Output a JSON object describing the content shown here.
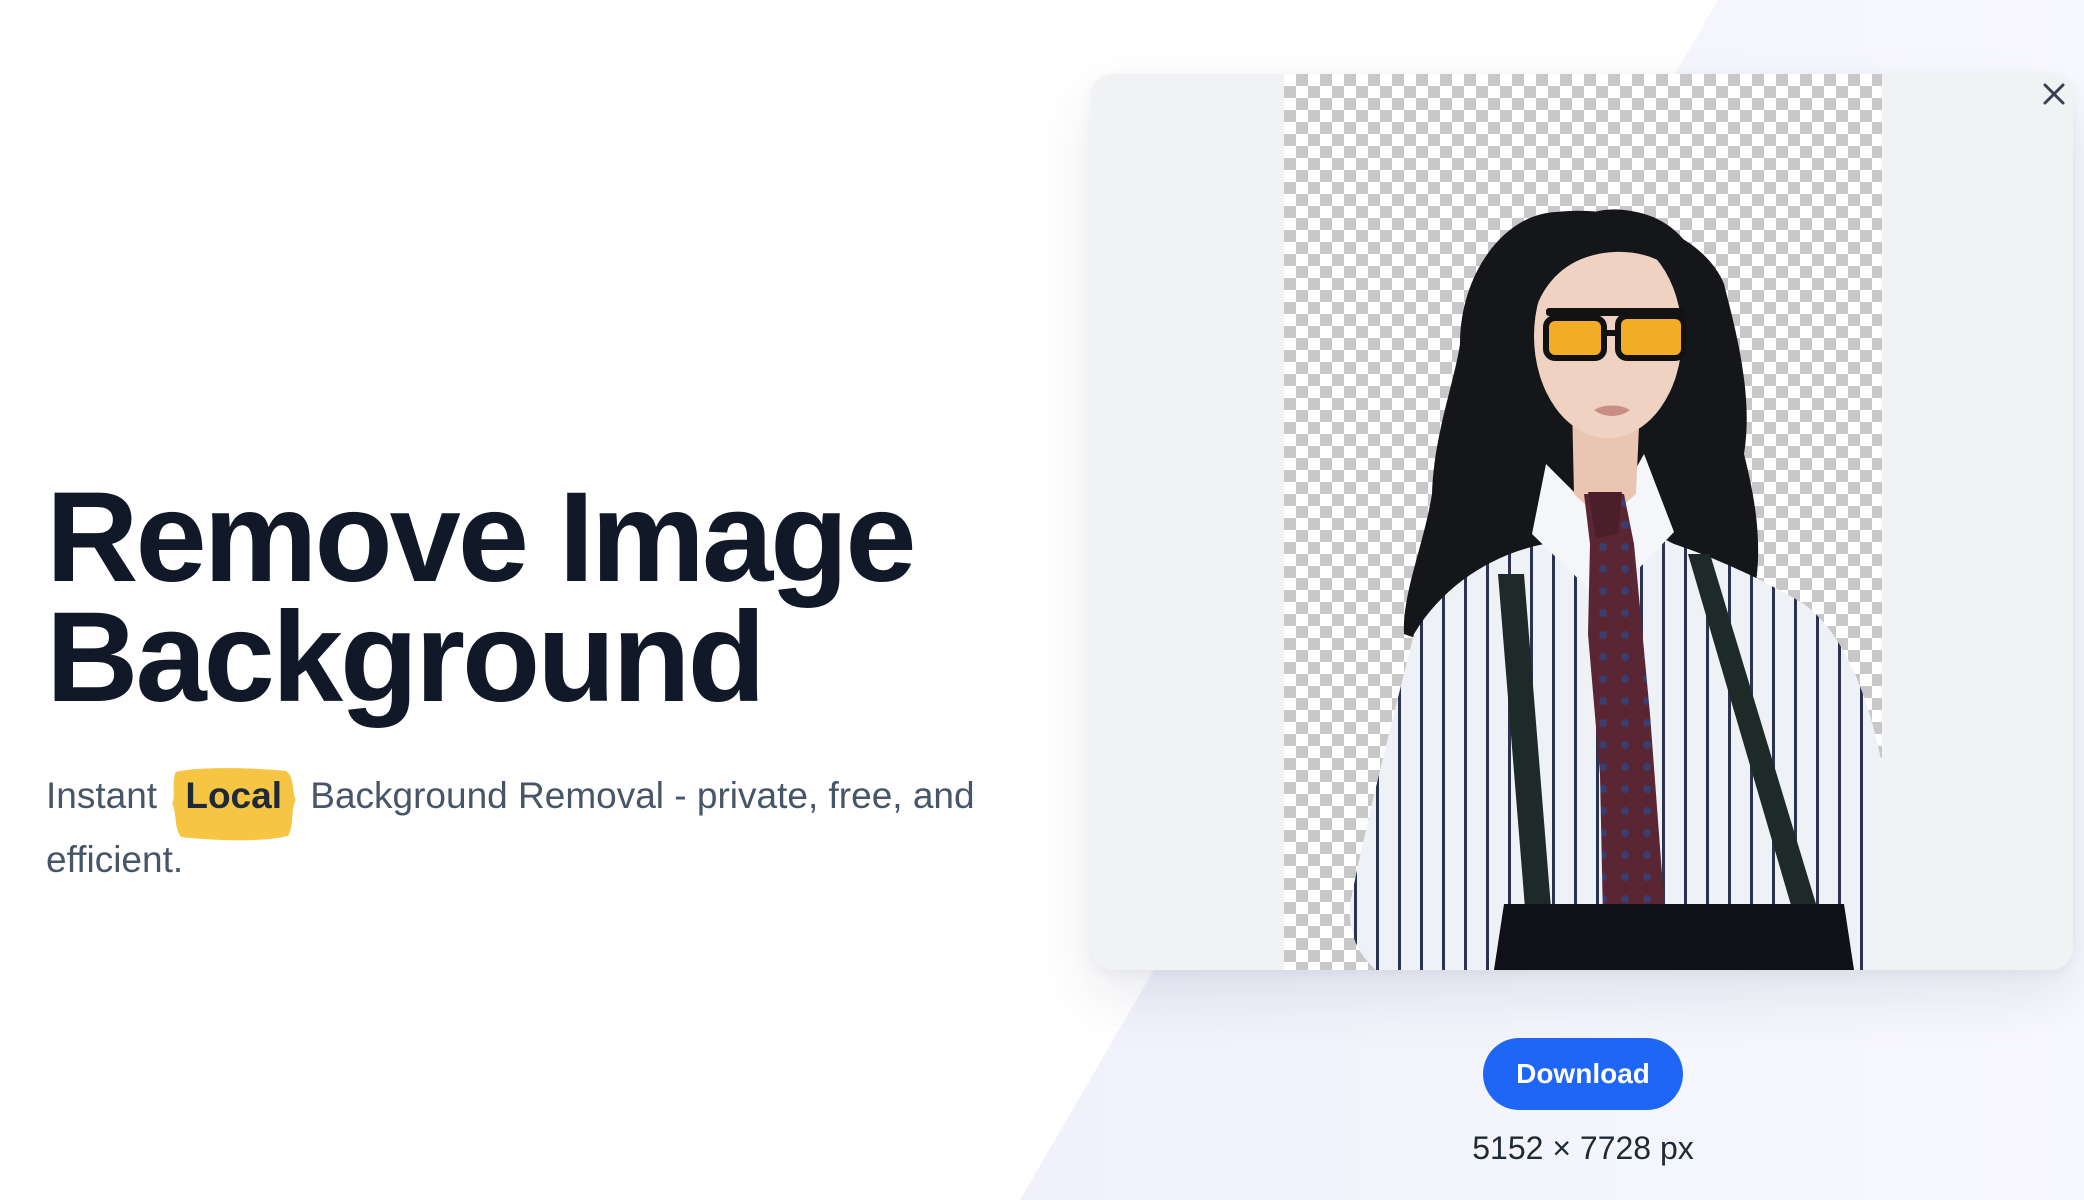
{
  "hero": {
    "title_line1": "Remove Image",
    "title_line2": "Background",
    "subtitle_before": "Instant",
    "subtitle_highlight": "Local",
    "subtitle_after": "Background Removal - private, free, and efficient."
  },
  "preview": {
    "close_icon": "close-icon",
    "download_label": "Download",
    "dimensions": "5152 × 7728 px"
  },
  "colors": {
    "accent": "#1e66f5",
    "highlight": "#f6c544",
    "title": "#111827",
    "subtitle": "#475569"
  }
}
